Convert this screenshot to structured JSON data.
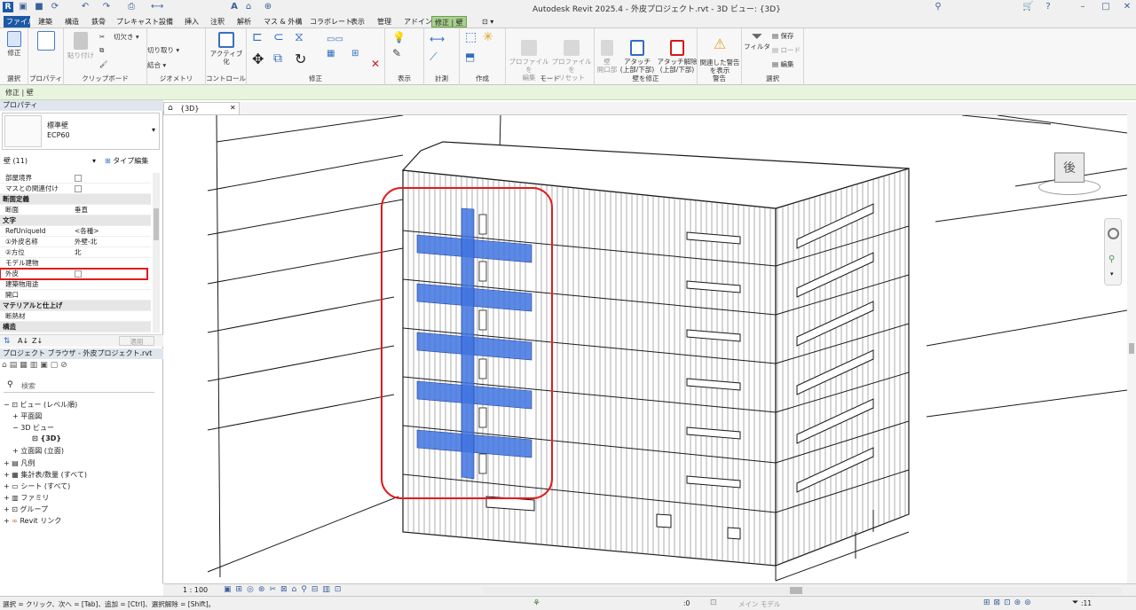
{
  "window": {
    "title": "Autodesk Revit 2025.4 - 外皮プロジェクト.rvt - 3D ビュー: {3D}"
  },
  "menu_tabs": [
    "ファイル",
    "建築",
    "構造",
    "鉄骨",
    "プレキャスト",
    "設備",
    "挿入",
    "注釈",
    "解析",
    "マス & 外構",
    "コラボレート",
    "表示",
    "管理",
    "アドイン",
    "修正 | 壁"
  ],
  "ribbon": {
    "modify_label": "修正",
    "paste_label": "貼り付け",
    "cut_label": "切欠き",
    "cut2_label": "切り取り",
    "join_label": "結合",
    "activate_label": "アクティブ化",
    "panels": {
      "select": "選択",
      "properties": "プロパティ",
      "clipboard": "クリップボード",
      "geometry": "ジオメトリ",
      "controls": "コントロール",
      "modify": "修正",
      "view": "表示",
      "measure": "計測",
      "create": "作成",
      "mode": "モード",
      "modify_wall": "壁を修正",
      "warning": "警告",
      "selection": "選択"
    },
    "mode_buttons": [
      "プロファイルを\n編集",
      "プロファイルを\nリセット"
    ],
    "wall_buttons": [
      "壁\n開口部",
      "アタッチ\n(上部/下部)",
      "アタッチ解除\n(上部/下部)"
    ],
    "warning_button": "関連した警告\nを表示",
    "filter_button": "フィルタ",
    "save_button": "保存",
    "load_button": "ロード",
    "edit_button": "編集"
  },
  "context_bar": "修正 | 壁",
  "properties": {
    "header": "プロパティ",
    "type_name": "標準壁",
    "type_sub": "ECP60",
    "instance_count": "壁 (11)",
    "edit_type": "タイプ編集",
    "rows": [
      {
        "k": "部屋境界",
        "v": "",
        "check": true,
        "group": false
      },
      {
        "k": "マスとの関連付け",
        "v": "",
        "check": true,
        "group": false
      },
      {
        "k": "断面定義",
        "v": "",
        "check": false,
        "group": true
      },
      {
        "k": "断面",
        "v": "垂直",
        "check": false,
        "group": false
      },
      {
        "k": "文字",
        "v": "",
        "check": false,
        "group": true
      },
      {
        "k": "RefUniqueId",
        "v": "<各種>",
        "check": false,
        "group": false
      },
      {
        "k": "①外皮名称",
        "v": "外壁-北",
        "check": false,
        "group": false
      },
      {
        "k": "②方位",
        "v": "北",
        "check": false,
        "group": false
      },
      {
        "k": "モデル建物",
        "v": "",
        "check": false,
        "group": false
      },
      {
        "k": "外皮",
        "v": "",
        "check": true,
        "group": false
      },
      {
        "k": "建築物用途",
        "v": "",
        "check": false,
        "group": false
      },
      {
        "k": "開口",
        "v": "",
        "check": false,
        "group": false
      },
      {
        "k": "マテリアルと仕上げ",
        "v": "",
        "check": false,
        "group": true
      },
      {
        "k": "断熱材",
        "v": "",
        "check": false,
        "group": false
      },
      {
        "k": "構造",
        "v": "",
        "check": false,
        "group": true
      }
    ],
    "apply": "適用"
  },
  "browser": {
    "header": "プロジェクト ブラウザ - 外皮プロジェクト.rvt",
    "search_placeholder": "検索",
    "nodes": [
      "ビュー (レベル順)",
      "平面図",
      "3D ビュー",
      "{3D}",
      "立面図 (立面)",
      "凡例",
      "集計表/数量 (すべて)",
      "シート (すべて)",
      "ファミリ",
      "グループ",
      "Revit リンク"
    ]
  },
  "view": {
    "tab": "{3D}",
    "scale": "1 : 100",
    "viewcube_face": "後"
  },
  "status": {
    "text": "選択 = クリック、次へ = [Tab]、追加 = [Ctrl]、選択解除 = [Shift]。",
    "model": "メイン モデル",
    "filter_count": ":11",
    "count_zero": ":0"
  },
  "colors": {
    "accent": "#1c5aa6",
    "selection_blue": "#3f74e0",
    "highlight_red": "#e21b1b",
    "context_green": "#a8d08d"
  }
}
